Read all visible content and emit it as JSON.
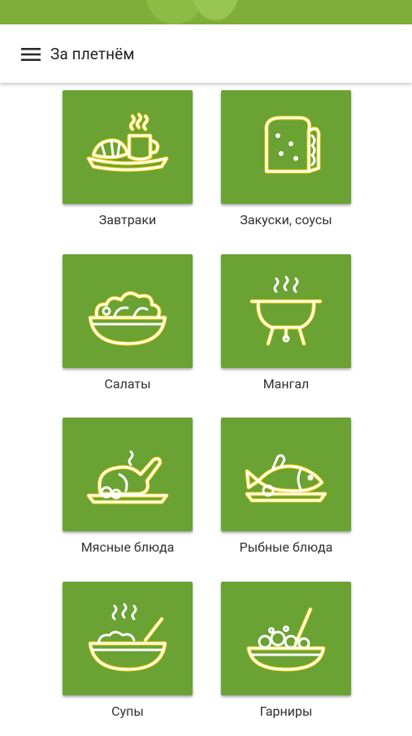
{
  "app": {
    "title": "За плетнём"
  },
  "categories": [
    {
      "label": "Завтраки",
      "icon": "breakfast-icon"
    },
    {
      "label": "Закуски, соусы",
      "icon": "sandwich-icon"
    },
    {
      "label": "Салаты",
      "icon": "salad-bowl-icon"
    },
    {
      "label": "Мангал",
      "icon": "grill-icon"
    },
    {
      "label": "Мясные блюда",
      "icon": "roast-chicken-icon"
    },
    {
      "label": "Рыбные блюда",
      "icon": "fish-dish-icon"
    },
    {
      "label": "Супы",
      "icon": "soup-bowl-icon"
    },
    {
      "label": "Гарниры",
      "icon": "side-dish-icon"
    }
  ],
  "colors": {
    "tile": "#6aa233",
    "outline": "#f2d200",
    "banner": "#7fae3a"
  }
}
